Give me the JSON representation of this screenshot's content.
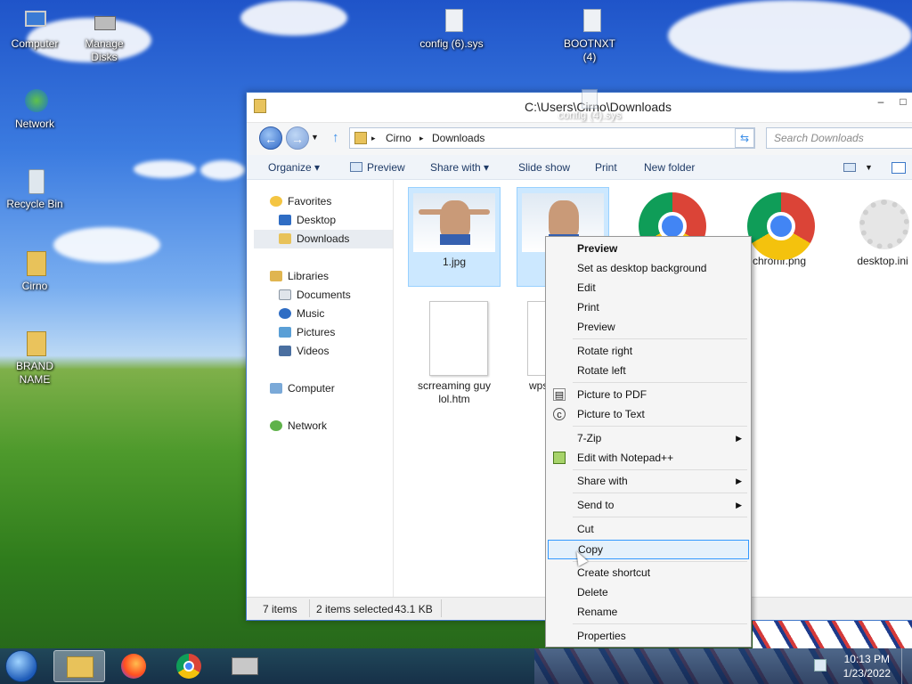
{
  "desktop": {
    "icons": [
      {
        "label": "Computer",
        "icon": "computer-icon"
      },
      {
        "label": "Manage Disks",
        "icon": "disk-manager-icon"
      },
      {
        "label": "Network",
        "icon": "network-icon"
      },
      {
        "label": "Recycle Bin",
        "icon": "recycle-bin-icon"
      },
      {
        "label": "Cirno",
        "icon": "user-folder-icon"
      },
      {
        "label": "BRAND NAME",
        "icon": "folder-icon"
      },
      {
        "label": "config (6).sys",
        "icon": "system-file-icon"
      },
      {
        "label": "BOOTNXT (4)",
        "icon": "system-file-icon"
      },
      {
        "label": "config (4).sys",
        "icon": "system-file-icon"
      }
    ]
  },
  "window": {
    "title": "C:\\Users\\Cirno\\Downloads",
    "controls": {
      "minimize": "–",
      "maximize": "□"
    },
    "address": {
      "segments": [
        "Cirno",
        "Downloads"
      ],
      "separator": "▸"
    },
    "search_placeholder": "Search Downloads",
    "commands": [
      "Organize ▾",
      "Preview",
      "Share with ▾",
      "Slide show",
      "Print",
      "New folder"
    ],
    "nav": {
      "favorites": "Favorites",
      "desktop": "Desktop",
      "downloads": "Downloads",
      "libraries": "Libraries",
      "documents": "Documents",
      "music": "Music",
      "pictures": "Pictures",
      "videos": "Videos",
      "computer": "Computer",
      "network": "Network"
    },
    "files": [
      {
        "name": "1.jpg",
        "selected": true
      },
      {
        "name": "",
        "selected": true
      },
      {
        "name": "",
        "selected": false
      },
      {
        "name": "chromr.png",
        "selected": false
      },
      {
        "name": "desktop.ini",
        "selected": false
      },
      {
        "name": "scrreaming guy lol.htm",
        "selected": false
      },
      {
        "name": "wps_",
        "selected": false
      }
    ],
    "status": {
      "items": "7 items",
      "selection": "2 items selected",
      "size": "43.1 KB"
    }
  },
  "context_menu": {
    "items": [
      {
        "label": "Preview",
        "bold": true
      },
      {
        "label": "Set as desktop background"
      },
      {
        "label": "Edit"
      },
      {
        "label": "Print"
      },
      {
        "label": "Preview"
      },
      {
        "label": "Rotate right"
      },
      {
        "label": "Rotate left"
      },
      {
        "label": "Picture to PDF",
        "icon": "pdf-icon"
      },
      {
        "label": "Picture to Text",
        "icon": "text-recognition-icon"
      },
      {
        "label": "7-Zip",
        "submenu": true
      },
      {
        "label": "Edit with Notepad++",
        "icon": "notepad-plus-icon"
      },
      {
        "label": "Share with",
        "submenu": true
      },
      {
        "label": "Send to",
        "submenu": true
      },
      {
        "label": "Cut"
      },
      {
        "label": "Copy",
        "highlighted": true
      },
      {
        "label": "Create shortcut"
      },
      {
        "label": "Delete"
      },
      {
        "label": "Rename"
      },
      {
        "label": "Properties"
      }
    ],
    "arrow": "▶"
  },
  "taskbar": {
    "time": "10:13 PM",
    "date": "1/23/2022",
    "pinned": [
      "explorer-icon",
      "firefox-icon",
      "chrome-icon",
      "disk-manager-icon"
    ]
  },
  "colors": {
    "selection": "#cce8ff",
    "menu_highlight": "#e5f1fb",
    "title_blue": "#3e74c8"
  }
}
